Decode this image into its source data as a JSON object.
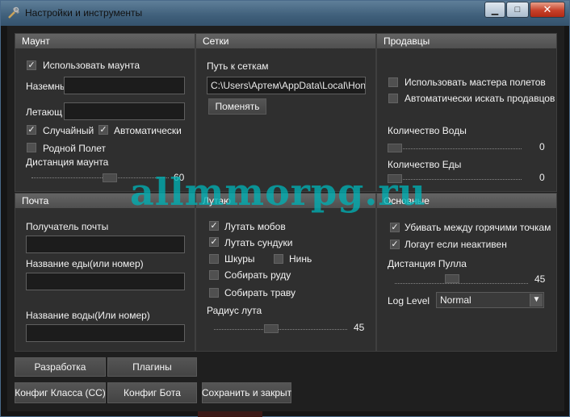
{
  "window": {
    "title": "Настройки и инструменты",
    "minimize_glyph": "▁",
    "maximize_glyph": "□",
    "close_glyph": "✕",
    "icon": "tools-icon"
  },
  "mount": {
    "header": "Маунт",
    "use_mount": {
      "label": "Использовать маунта",
      "checked": true
    },
    "ground_label": "Наземны",
    "ground_value": "",
    "flying_label": "Летающ",
    "flying_value": "",
    "random": {
      "label": "Случайный",
      "checked": true
    },
    "auto": {
      "label": "Автоматически",
      "checked": true
    },
    "native_flight": {
      "label": "Родной Полет",
      "checked": false
    },
    "distance_label": "Дистанция маунта",
    "distance_value": "60"
  },
  "meshes": {
    "header": "Сетки",
    "path_label": "Путь к сеткам",
    "path_value": "C:\\Users\\Артем\\AppData\\Local\\Hon",
    "change_button": "Поменять"
  },
  "vendors": {
    "header": "Продавцы",
    "use_flight_master": {
      "label": "Использовать мастера полетов",
      "checked": false
    },
    "auto_find_vendors": {
      "label": "Автоматически искать продавцов",
      "checked": false
    },
    "water_label": "Количество Воды",
    "water_value": "0",
    "food_label": "Количество Еды",
    "food_value": "0"
  },
  "mail": {
    "header": "Почта",
    "recipient_label": "Получатель почты",
    "recipient_value": "",
    "food_name_label": "Название еды(или номер)",
    "food_name_value": "",
    "water_name_label": "Название воды(Или номер)",
    "water_name_value": ""
  },
  "loot": {
    "header": "Лутаю",
    "mobs": {
      "label": "Лутать мобов",
      "checked": true
    },
    "chests": {
      "label": "Лутать сундуки",
      "checked": true
    },
    "skins": {
      "label": "Шкуры",
      "checked": false
    },
    "nin": {
      "label": "Нинь",
      "checked": false
    },
    "ore": {
      "label": "Собирать руду",
      "checked": false
    },
    "herbs": {
      "label": "Собирать траву",
      "checked": false
    },
    "radius_label": "Радиус лута",
    "radius_value": "45"
  },
  "general": {
    "header": "Основные",
    "kill_between_hotspots": {
      "label": "Убивать между горячими точкам",
      "checked": true
    },
    "logout_inactive": {
      "label": "Логаут если неактивен",
      "checked": true
    },
    "pull_distance_label": "Дистанция Пулла",
    "pull_distance_value": "45",
    "log_level_label": "Log Level",
    "log_level_value": "Normal"
  },
  "bottom_buttons": {
    "dev": "Разработка",
    "plugins": "Плагины",
    "class_config": "Конфиг Класса (CC)",
    "bot_config": "Конфиг Бота",
    "save_close": "Сохранить и закрыт"
  },
  "watermark": "allmmorpg.ru",
  "colors": {
    "panel_bg": "#2f2f2f",
    "header_bg": "#585858",
    "titlebar": "#4a6a85",
    "watermark": "#00afb4"
  }
}
